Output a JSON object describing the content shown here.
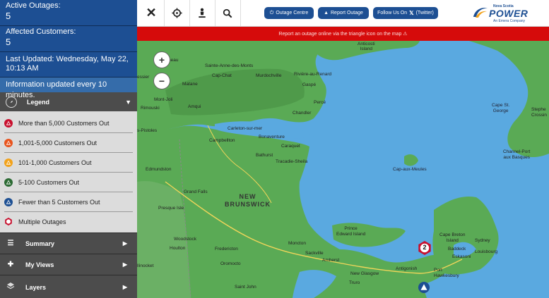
{
  "sidebar": {
    "active_outages_label": "Active Outages:",
    "active_outages_value": "5",
    "affected_customers_label": "Affected Customers:",
    "affected_customers_value": "5",
    "last_updated": "Last Updated: Wednesday, May 22, 10:13 AM",
    "info_text": "Information updated every 10 minutes.",
    "legend_title": "Legend",
    "legend_items": [
      {
        "label": "More than 5,000 Customers Out",
        "color": "#c8102e"
      },
      {
        "label": "1,001-5,000 Customers Out",
        "color": "#e8541e"
      },
      {
        "label": "101-1,000 Customers Out",
        "color": "#f2a21b"
      },
      {
        "label": "5-100 Customers Out",
        "color": "#2b6a33"
      },
      {
        "label": "Fewer than 5 Customers Out",
        "color": "#1d4f93"
      },
      {
        "label": "Multiple Outages",
        "color": "#c8102e"
      }
    ],
    "panels": [
      {
        "label": "Summary",
        "icon": "list-icon"
      },
      {
        "label": "My Views",
        "icon": "plus-icon"
      },
      {
        "label": "Layers",
        "icon": "layers-icon"
      }
    ]
  },
  "toolbar": {
    "outage_centre": "Outage Centre",
    "report_outage": "Report Outage",
    "follow_us": "Follow Us On",
    "twitter": "(Twitter)",
    "logo_small": "Nova Scotia",
    "logo_main": "POWER",
    "logo_sub": "An Emera Company"
  },
  "alert_text": "Report an outage online via the triangle icon on the map ⚠",
  "map": {
    "zoom_in": "+",
    "zoom_out": "−",
    "cluster_count": "2",
    "places": {
      "anticosti": "Anticosti\nIsland",
      "sainte_anne": "Sainte-Anne-des-Monts",
      "cap_chat": "Cap-Chat",
      "murdochville": "Murdochville",
      "riviere_renard": "Rivière-au-Renard",
      "gaspe": "Gaspé",
      "matane": "Matane",
      "mont_joli": "Mont-Joli",
      "rimouski": "Rimouski",
      "amqui": "Amqui",
      "perce": "Percé",
      "chandler": "Chandler",
      "pistoles": "s-Pistoles",
      "carleton": "Carleton-sur-mer",
      "bonaventure": "Bonaventure",
      "campbellton": "Campbellton",
      "caraquet": "Caraquet",
      "bathurst": "Bathurst",
      "tracadie": "Tracadie-Sheila",
      "edmundston": "Edmundston",
      "grand_falls": "Grand Falls",
      "new_brunswick": "NEW\nBRUNSWICK",
      "presque_isle": "Presque Isle",
      "woodstock": "Woodstock",
      "houlton": "Houlton",
      "fredericton": "Fredericton",
      "oromocto": "Oromocto",
      "moncton": "Moncton",
      "sackville": "Sackville",
      "amherst": "Amherst",
      "truro": "Truro",
      "new_glasgow": "New Glasgow",
      "antigonish": "Antigonish",
      "port_hawkesbury": "Port\nHawkesbury",
      "cape_breton": "Cape Breton\nIsland",
      "sydney": "Sydney",
      "baddeck": "Baddeck",
      "louisbourg": "Louisbourg",
      "eskasoni": "Eskasoni",
      "pei": "Prince\nEdward Island",
      "cap_madeleine": "Cap-aux-Meules",
      "cape_st_george": "Cape St.\nGeorge",
      "stephenville": "Stephe\nCrossin",
      "channel_port": "Channel-Port\naux Basques",
      "saint_john": "Saint John",
      "millinocket": "llinocket",
      "esser": "essier",
      "neau": "neau"
    }
  }
}
